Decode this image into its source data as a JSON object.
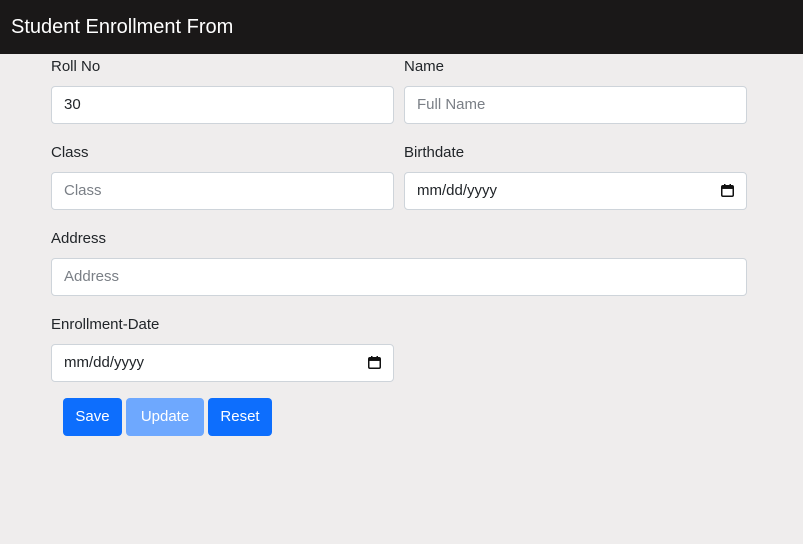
{
  "header": {
    "title": "Student Enrollment From"
  },
  "form": {
    "roll_no": {
      "label": "Roll No",
      "value": "30"
    },
    "name": {
      "label": "Name",
      "placeholder": "Full Name"
    },
    "class": {
      "label": "Class",
      "placeholder": "Class"
    },
    "birthdate": {
      "label": "Birthdate",
      "value": "mm/dd/yyyy",
      "icon": "calendar-icon"
    },
    "address": {
      "label": "Address",
      "placeholder": "Address"
    },
    "enrollment_date": {
      "label": "Enrollment-Date",
      "value": "mm/dd/yyyy",
      "icon": "calendar-icon"
    }
  },
  "buttons": {
    "save": "Save",
    "update": "Update",
    "reset": "Reset"
  },
  "colors": {
    "primary": "#0d6efd",
    "primary_disabled": "#6ea8fe",
    "navbar": "#1a1818",
    "page_background": "#efeded"
  }
}
